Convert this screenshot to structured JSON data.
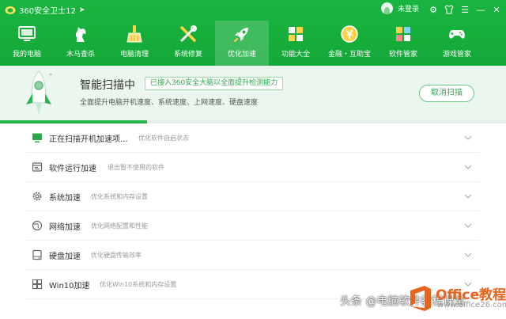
{
  "app": {
    "title": "360安全卫士12",
    "user_label": "未登录"
  },
  "nav": [
    {
      "label": "我的电脑",
      "icon": "monitor-icon"
    },
    {
      "label": "木马查杀",
      "icon": "trojan-horse-icon"
    },
    {
      "label": "电脑清理",
      "icon": "broom-icon"
    },
    {
      "label": "系统修复",
      "icon": "wrench-screwdriver-icon"
    },
    {
      "label": "优化加速",
      "icon": "rocket-icon",
      "active": true
    },
    {
      "label": "功能大全",
      "icon": "grid-icon"
    },
    {
      "label": "金融・互助宝",
      "icon": "coin-icon"
    },
    {
      "label": "软件管家",
      "icon": "software-manager-icon"
    },
    {
      "label": "游戏管家",
      "icon": "gamepad-icon"
    }
  ],
  "banner": {
    "title": "智能扫描中",
    "tag": "已接入360安全大脑以全面提升检测能力",
    "subtitle": "全面提升电脑开机速度、系统速度、上网速度、硬盘速度",
    "cancel_label": "取消扫描",
    "progress": 0.29
  },
  "items": [
    {
      "title": "正在扫描开机加速项...",
      "desc": "优化软件自启状态",
      "icon": "startup-monitor-icon"
    },
    {
      "title": "软件运行加速",
      "desc": "退出暂不使用的软件",
      "icon": "software-run-icon"
    },
    {
      "title": "系统加速",
      "desc": "优化系统和内存设置",
      "icon": "settings-gear-icon"
    },
    {
      "title": "网络加速",
      "desc": "优化网络配置和性能",
      "icon": "network-globe-icon"
    },
    {
      "title": "硬盘加速",
      "desc": "优化硬盘传输效率",
      "icon": "hard-disk-icon"
    },
    {
      "title": "Win10加速",
      "desc": "优化Win10系统和内存设置",
      "icon": "windows-logo-icon"
    }
  ],
  "watermark": {
    "text": "头条 @电脑软件教程课堂",
    "brand": "Office教程网",
    "url": "www.office26.com"
  },
  "colors": {
    "header_green": "#19b53f",
    "accent": "#25b34b",
    "banner_bg": "#eaf6ee"
  }
}
